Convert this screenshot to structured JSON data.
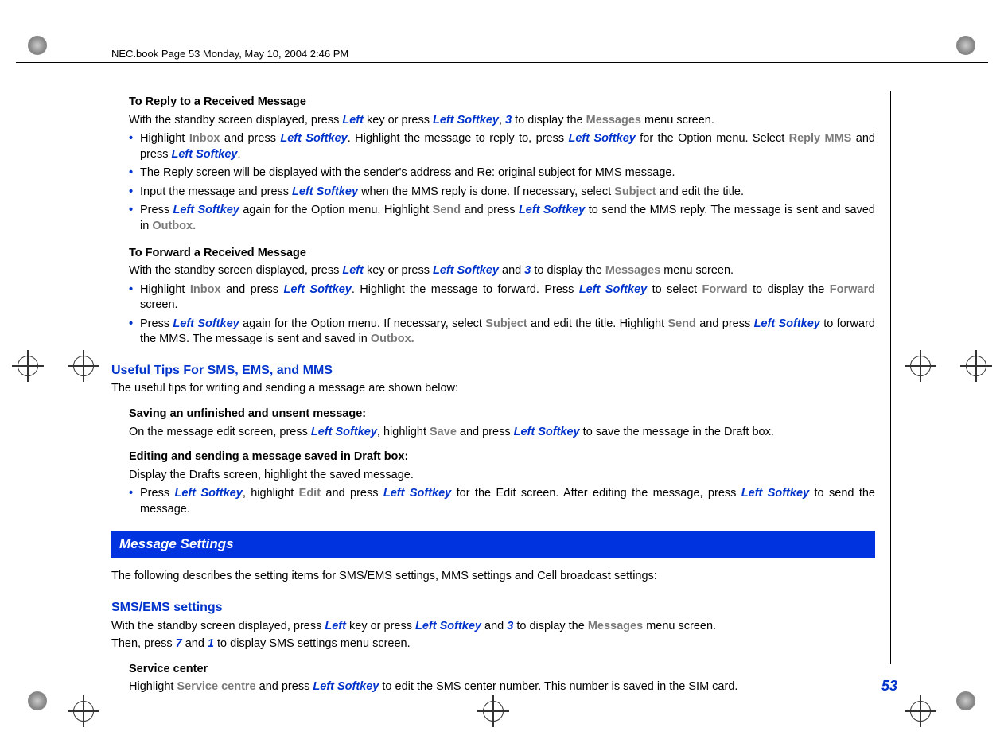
{
  "header": "NEC.book  Page 53  Monday, May 10, 2004  2:46 PM",
  "reply": {
    "title": "To Reply to a Received Message",
    "intro_a": "With the standby screen displayed, press ",
    "intro_b": " key or press ",
    "intro_c": ", ",
    "intro_d": " to display the ",
    "intro_e": " menu screen.",
    "k_left": "Left",
    "k_leftsoft": "Left Softkey",
    "k_3": "3",
    "k_messages": "Messages",
    "b1a": "Highlight ",
    "b1_inbox": "Inbox",
    "b1b": " and press ",
    "b1c": ". Highlight the message to reply to, press ",
    "b1d": " for the Option menu. Select ",
    "b1_reply": "Reply MMS",
    "b1e": " and press ",
    "b1f": ".",
    "b2": "The Reply screen will be displayed with the sender's address and Re: original subject for MMS message.",
    "b3a": "Input the message and press ",
    "b3b": " when the MMS reply is done. If necessary, select ",
    "b3_subj": "Subject",
    "b3c": " and edit the title.",
    "b4a": "Press ",
    "b4b": " again for the Option menu. Highlight ",
    "b4_send": "Send",
    "b4c": " and press ",
    "b4d": " to send the MMS reply. The message is sent and saved in ",
    "b4_outbox": "Outbox.",
    "b4e": ""
  },
  "forward": {
    "title": "To Forward a Received Message",
    "intro_a": "With the standby screen displayed, press ",
    "intro_b": " key or press ",
    "intro_c": " and ",
    "intro_d": " to display the ",
    "intro_e": " menu screen.",
    "b1a": "Highlight ",
    "b1_inbox": "Inbox",
    "b1b": " and press ",
    "b1c": ". Highlight the message to forward. Press ",
    "b1d": " to select ",
    "b1_fwd": "Forward",
    "b1e": " to display the ",
    "b1_fwd2": "Forward",
    "b1f": " screen.",
    "b2a": "Press ",
    "b2b": " again for the Option menu. If necessary, select ",
    "b2_subj": "Subject",
    "b2c": " and edit the title. Highlight ",
    "b2_send": "Send",
    "b2d": " and press ",
    "b2e": " to forward the MMS. The message is sent and saved in ",
    "b2_outbox": "Outbox.",
    "b2f": ""
  },
  "tips": {
    "heading": "Useful Tips For SMS, EMS, and MMS",
    "intro": "The useful tips for writing and sending a message are shown below:",
    "save_title": "Saving an unfinished and unsent message:",
    "save_a": "On the message edit screen, press ",
    "save_b": ", highlight ",
    "save_save": "Save",
    "save_c": " and press ",
    "save_d": " to save the message in the Draft box.",
    "edit_title": "Editing and sending a message saved in Draft box:",
    "edit_intro": "Display the Drafts screen, highlight the saved message.",
    "edit_b1a": "Press ",
    "edit_b1b": ", highlight ",
    "edit_edit": "Edit",
    "edit_b1c": " and press ",
    "edit_b1d": " for the Edit screen. After editing the message, press ",
    "edit_b1e": " to send the message."
  },
  "settings": {
    "banner": "Message Settings",
    "intro": "The following describes the setting items for SMS/EMS settings, MMS settings and Cell broadcast settings:",
    "sms_heading": "SMS/EMS settings",
    "sms_a": "With the standby screen displayed, press ",
    "sms_b": " key or press ",
    "sms_c": " and ",
    "sms_d": " to display the ",
    "sms_e": " menu screen.",
    "then_a": "Then, press ",
    "k_7": "7",
    "then_b": " and ",
    "k_1": "1",
    "then_c": " to display SMS settings menu screen.",
    "svc_title": "Service center",
    "svc_a": "Highlight ",
    "svc_centre": "Service centre",
    "svc_b": " and press ",
    "svc_c": " to edit the SMS center number. This number is saved in the SIM card."
  },
  "page_number": "53"
}
